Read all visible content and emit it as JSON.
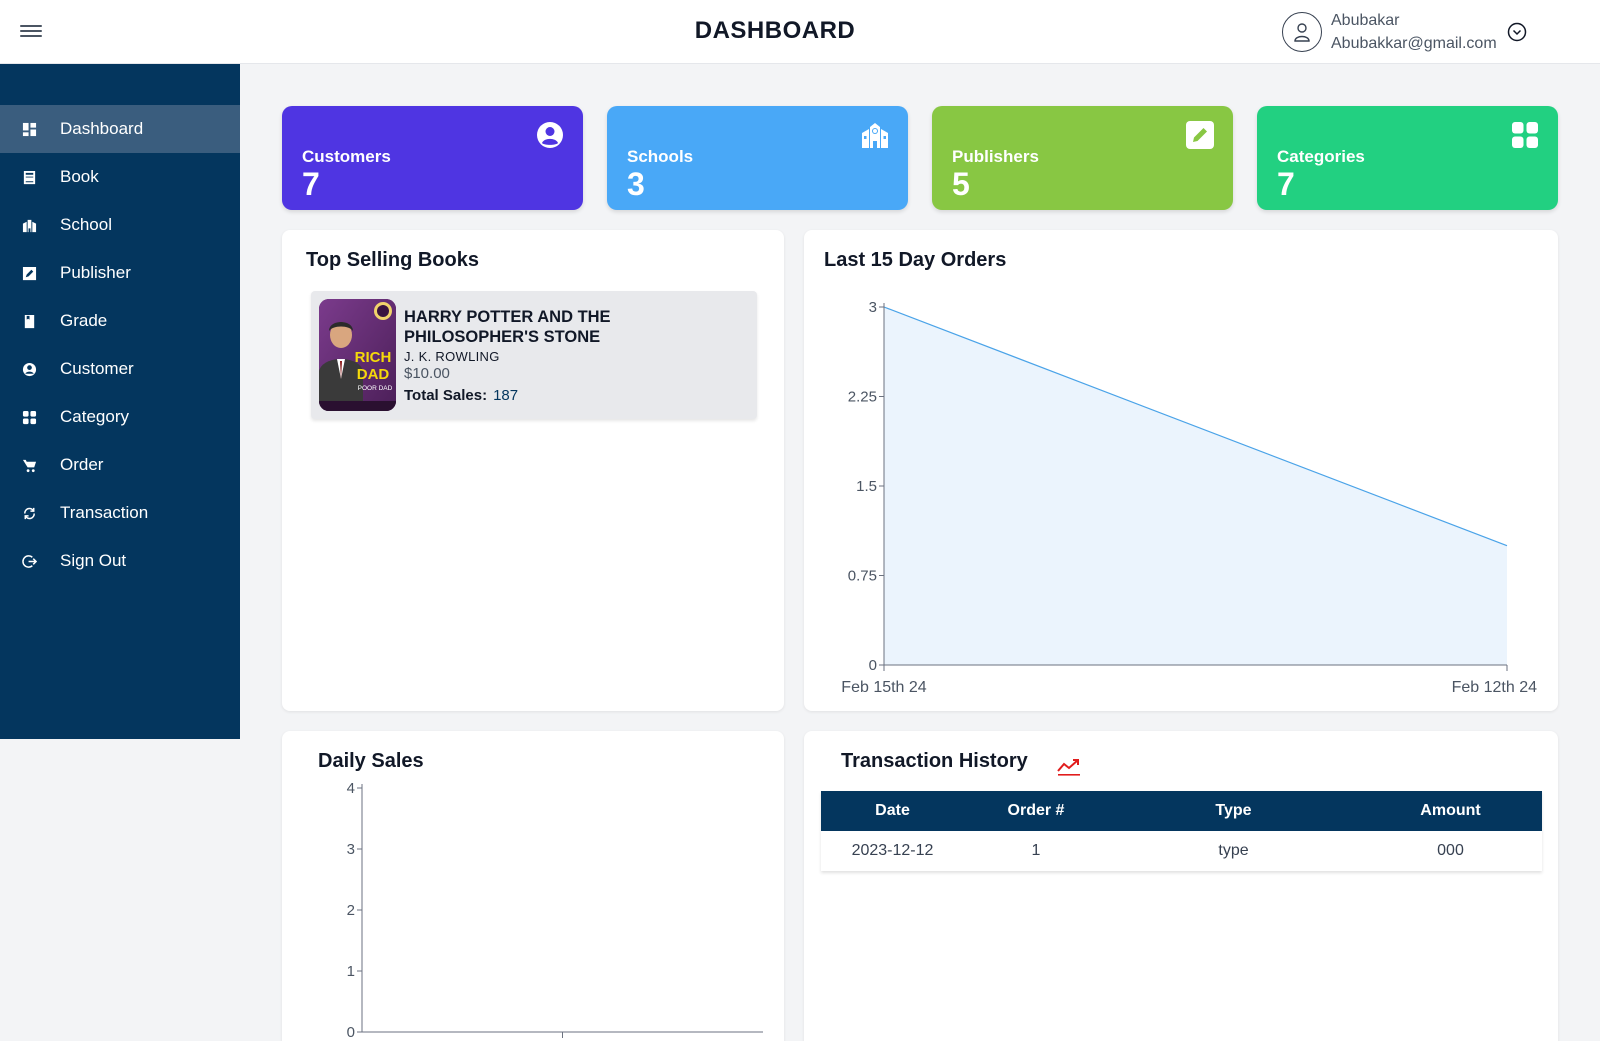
{
  "header": {
    "title": "DASHBOARD",
    "user_name": "Abubakar",
    "user_email": "Abubakkar@gmail.com"
  },
  "sidebar": {
    "items": [
      {
        "label": "Dashboard",
        "icon": "dashboard-icon",
        "active": true
      },
      {
        "label": "Book",
        "icon": "book-icon"
      },
      {
        "label": "School",
        "icon": "school-icon"
      },
      {
        "label": "Publisher",
        "icon": "publisher-icon"
      },
      {
        "label": "Grade",
        "icon": "grade-icon"
      },
      {
        "label": "Customer",
        "icon": "customer-icon"
      },
      {
        "label": "Category",
        "icon": "category-icon"
      },
      {
        "label": "Order",
        "icon": "cart-icon"
      },
      {
        "label": "Transaction",
        "icon": "transaction-icon"
      },
      {
        "label": "Sign Out",
        "icon": "sign-out-icon"
      }
    ]
  },
  "stats": [
    {
      "label": "Customers",
      "value": "7",
      "color": "#4f35e2",
      "icon": "user-circle-icon"
    },
    {
      "label": "Schools",
      "value": "3",
      "color": "#49a8f7",
      "icon": "school-icon"
    },
    {
      "label": "Publishers",
      "value": "5",
      "color": "#88c743",
      "icon": "pencil-box-icon"
    },
    {
      "label": "Categories",
      "value": "7",
      "color": "#22d081",
      "icon": "grid-icon"
    }
  ],
  "top_selling": {
    "title": "Top Selling Books",
    "book": {
      "title": "HARRY POTTER AND THE PHILOSOPHER'S STONE",
      "author": "J. K. ROWLING",
      "price": "$10.00",
      "sales_label": "Total Sales:",
      "sales_value": "187",
      "cover_text_1": "RICH",
      "cover_text_2": "DAD",
      "cover_text_3": "POOR DAD"
    }
  },
  "orders_chart": {
    "title": "Last 15 Day Orders"
  },
  "daily_sales": {
    "title": "Daily Sales"
  },
  "transactions": {
    "title": "Transaction History",
    "columns": [
      "Date",
      "Order #",
      "Type",
      "Amount"
    ],
    "rows": [
      [
        "2023-12-12",
        "1",
        "type",
        "000"
      ]
    ]
  },
  "chart_data": [
    {
      "type": "area",
      "title": "Last 15 Day Orders",
      "x": [
        "Feb 15th 24",
        "Feb 12th 24"
      ],
      "values": [
        3,
        1
      ],
      "yticks": [
        "0",
        "0.75",
        "1.5",
        "2.25",
        "3"
      ],
      "ylim": [
        0,
        3
      ],
      "color": "#4aa3e8",
      "fill": "#ebf4fd"
    },
    {
      "type": "bar",
      "title": "Daily Sales",
      "categories": [],
      "values": [],
      "yticks": [
        "0",
        "1",
        "2",
        "3",
        "4"
      ],
      "ylim": [
        0,
        4
      ]
    }
  ]
}
